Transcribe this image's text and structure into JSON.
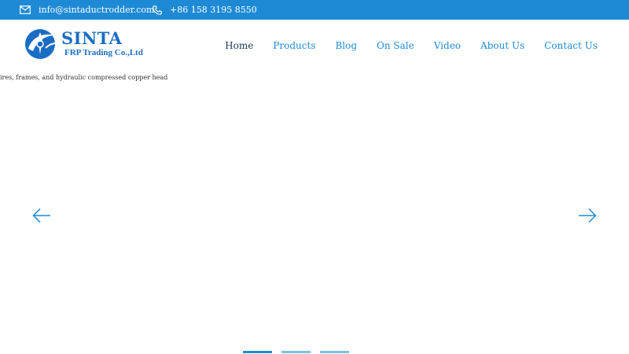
{
  "topbar": {
    "email": "info@sintaductrodder.com",
    "phone": "+86 158 3195 8550",
    "email_icon": "envelope-icon",
    "phone_icon": "phone-icon"
  },
  "brand": {
    "name": "SINTA",
    "subtitle": "FRP Trading Co.,Ltd",
    "color": "#1a6dc4"
  },
  "nav": {
    "items": [
      {
        "label": "Home",
        "active": true
      },
      {
        "label": "Products"
      },
      {
        "label": "Blog"
      },
      {
        "label": "On Sale"
      },
      {
        "label": "Video"
      },
      {
        "label": "About Us"
      },
      {
        "label": "Contact Us"
      }
    ]
  },
  "banner": {
    "caption": "ires, frames, and hydraulic compressed copper head",
    "prev_icon": "arrow-left-icon",
    "next_icon": "arrow-right-icon",
    "slide_count": 3,
    "active_slide": 1
  },
  "colors": {
    "accent": "#1e8ad6",
    "nav_active": "#1c3a57",
    "dot_inactive": "#7fbfe8"
  }
}
